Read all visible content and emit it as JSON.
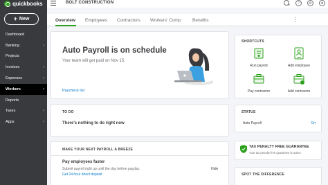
{
  "app": {
    "logo_text": "quickbooks",
    "new_button": "New"
  },
  "sidebar": {
    "items": [
      {
        "label": "Dashboard",
        "chevron": ""
      },
      {
        "label": "Banking",
        "chevron": "›"
      },
      {
        "label": "Projects",
        "chevron": ""
      },
      {
        "label": "Invoices",
        "chevron": "›"
      },
      {
        "label": "Expenses",
        "chevron": "›"
      },
      {
        "label": "Workers",
        "chevron": "›"
      },
      {
        "label": "Reports",
        "chevron": ""
      },
      {
        "label": "Taxes",
        "chevron": "›"
      },
      {
        "label": "Apps",
        "chevron": "›"
      }
    ],
    "active_index": 5
  },
  "topbar": {
    "company_name": "BOLT CONSTRUCTION",
    "help_icon": "?",
    "settings_icon": "⚙"
  },
  "tabs": [
    {
      "label": "Overview"
    },
    {
      "label": "Employees"
    },
    {
      "label": "Contractors"
    },
    {
      "label": "Workers' Comp"
    },
    {
      "label": "Benefits"
    }
  ],
  "more_tabs": "⋮",
  "hero": {
    "title": "Auto Payroll is on schedule",
    "subtitle": "Your team will get paid on Nov 15.",
    "link": "Paycheck list"
  },
  "todo": {
    "heading": "TO DO",
    "message": "There's nothing to do right now"
  },
  "breeze": {
    "heading": "MAKE YOUR NEXT PAYROLL A BREEZE",
    "title": "Pay employees faster",
    "description": "Submit payroll right up until the day before payday.",
    "link": "Get 24 hour direct deposit",
    "hide": "Hide"
  },
  "shortcuts": {
    "heading": "SHORTCUTS",
    "items": [
      {
        "label": "Run payroll",
        "icon": "run-payroll-icon"
      },
      {
        "label": "Add employee",
        "icon": "add-employee-icon"
      },
      {
        "label": "Pay contractor",
        "icon": "pay-contractor-icon"
      },
      {
        "label": "Add contractor",
        "icon": "add-contractor-icon"
      }
    ]
  },
  "status": {
    "heading": "STATUS",
    "label": "Auto Payroll",
    "value": "On"
  },
  "tax": {
    "title": "TAX PENALTY FREE GUARANTEE",
    "subtitle": "Your tax penalty free guarantee is active."
  },
  "spot": {
    "heading": "SPOT THE DIFFERENCE"
  },
  "colors": {
    "brand": "#2ca01c",
    "link": "#0077c5",
    "sidebar": "#393a3d"
  }
}
